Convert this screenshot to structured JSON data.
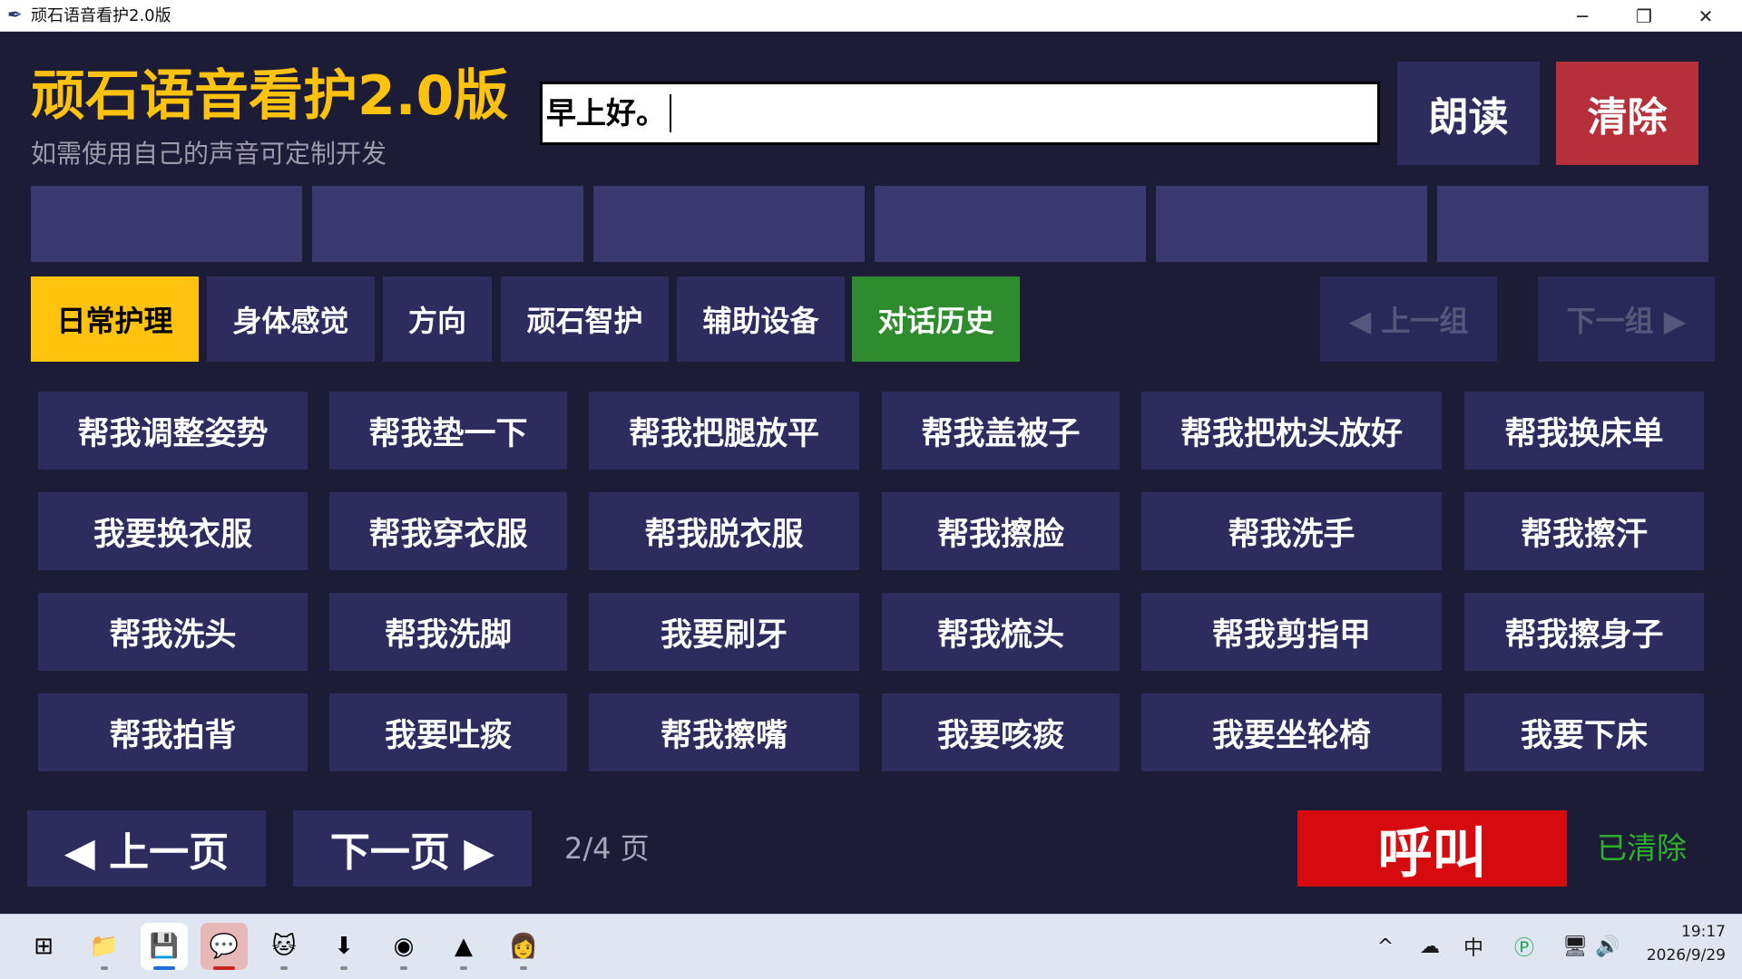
{
  "window": {
    "title": "顽石语音看护2.0版",
    "minimize_glyph": "─",
    "restore_glyph": "❐",
    "close_glyph": "✕"
  },
  "header": {
    "app_title": "顽石语音看护2.0版",
    "subtitle": "如需使用自己的声音可定制开发"
  },
  "speech_input": {
    "value": "早上好。"
  },
  "actions": {
    "read_label": "朗读",
    "clear_label": "清除"
  },
  "tabs": [
    {
      "label": "日常护理",
      "color": "#ffc20e",
      "text_color": "#000000",
      "active": true
    },
    {
      "label": "身体感觉",
      "color": "#2e2b5f",
      "text_color": "#ffffff"
    },
    {
      "label": "方向",
      "color": "#2e2b5f",
      "text_color": "#ffffff"
    },
    {
      "label": "顽石智护",
      "color": "#2e2b5f",
      "text_color": "#ffffff"
    },
    {
      "label": "辅助设备",
      "color": "#2e2b5f",
      "text_color": "#ffffff"
    },
    {
      "label": "对话历史",
      "color": "#2e8b2e",
      "text_color": "#ffffff"
    }
  ],
  "group_nav": {
    "prev_label": "◀ 上一组",
    "next_label": "下一组 ▶"
  },
  "phrases": [
    [
      "帮我调整姿势",
      "帮我垫一下",
      "帮我把腿放平",
      "帮我盖被子",
      "帮我把枕头放好",
      "帮我换床单"
    ],
    [
      "我要换衣服",
      "帮我穿衣服",
      "帮我脱衣服",
      "帮我擦脸",
      "帮我洗手",
      "帮我擦汗"
    ],
    [
      "帮我洗头",
      "帮我洗脚",
      "我要刷牙",
      "帮我梳头",
      "帮我剪指甲",
      "帮我擦身子"
    ],
    [
      "帮我拍背",
      "我要吐痰",
      "帮我擦嘴",
      "我要咳痰",
      "我要坐轮椅",
      "我要下床"
    ]
  ],
  "footer": {
    "prev_page": "◀ 上一页",
    "next_page": "下一页 ▶",
    "page_indicator": "2/4 页",
    "call_label": "呼叫",
    "status": "已清除"
  },
  "colors": {
    "background": "#1c1c36",
    "button": "#2e2b5f",
    "slot": "#3a3870",
    "accent_yellow": "#ffc20e",
    "clear_red": "#b5303a",
    "call_red": "#d60b0f",
    "status_green": "#2eb22e"
  },
  "taskbar": {
    "apps": [
      {
        "name": "windows-start-icon",
        "glyph": "⊞"
      },
      {
        "name": "file-explorer-icon",
        "glyph": "📁"
      },
      {
        "name": "python-app-icon",
        "glyph": "💾"
      },
      {
        "name": "wechat-icon",
        "glyph": "💬"
      },
      {
        "name": "cat-app-icon",
        "glyph": "🐱"
      },
      {
        "name": "download-app-icon",
        "glyph": "⬇"
      },
      {
        "name": "chrome-icon",
        "glyph": "◉"
      },
      {
        "name": "vlc-icon",
        "glyph": "▲"
      },
      {
        "name": "assistant-avatar-icon",
        "glyph": "👩"
      }
    ],
    "tray": {
      "chevron": "^",
      "cloud": "☁",
      "ime": "中",
      "payment": "Ⓟ",
      "network": "🖥",
      "volume": "🔊"
    },
    "time": "19:17",
    "date": "2026/9/29"
  }
}
